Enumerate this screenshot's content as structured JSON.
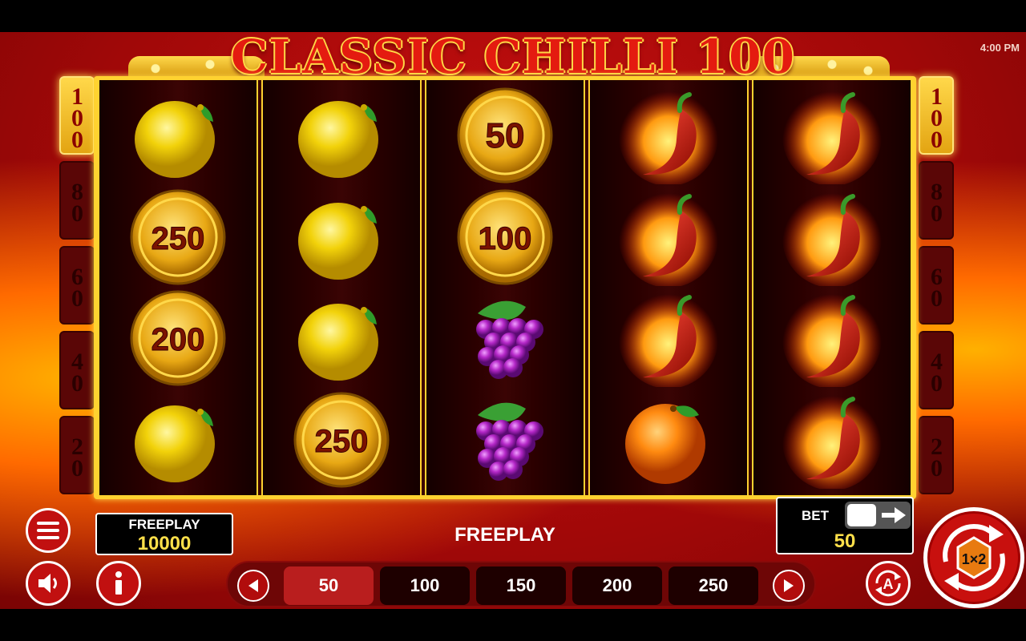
{
  "clock": "4:00 PM",
  "title": "CLASSIC CHILLI 100",
  "ladder_left": [
    "100",
    "80",
    "60",
    "40",
    "20"
  ],
  "ladder_right": [
    "100",
    "80",
    "60",
    "40",
    "20"
  ],
  "reels": [
    [
      {
        "type": "lemon"
      },
      {
        "type": "coin",
        "value": "250"
      },
      {
        "type": "coin",
        "value": "200"
      },
      {
        "type": "lemon"
      }
    ],
    [
      {
        "type": "lemon"
      },
      {
        "type": "lemon"
      },
      {
        "type": "lemon"
      },
      {
        "type": "coin",
        "value": "250"
      }
    ],
    [
      {
        "type": "coin",
        "value": "50"
      },
      {
        "type": "coin",
        "value": "100"
      },
      {
        "type": "grapes"
      },
      {
        "type": "grapes"
      }
    ],
    [
      {
        "type": "chilli"
      },
      {
        "type": "chilli"
      },
      {
        "type": "chilli"
      },
      {
        "type": "orange"
      }
    ],
    [
      {
        "type": "chilli"
      },
      {
        "type": "chilli"
      },
      {
        "type": "chilli"
      },
      {
        "type": "chilli"
      }
    ]
  ],
  "balance": {
    "label": "FREEPLAY",
    "value": "10000"
  },
  "status_text": "FREEPLAY",
  "bet": {
    "label": "BET",
    "value": "50"
  },
  "bet_options": [
    "50",
    "100",
    "150",
    "200",
    "250"
  ],
  "selected_bet": "50",
  "autoplay_letter": "A",
  "spin_logo": "1×2",
  "colors": {
    "accent_gold": "#ffd230",
    "red": "#c8100e",
    "value_yellow": "#ffe04a"
  }
}
